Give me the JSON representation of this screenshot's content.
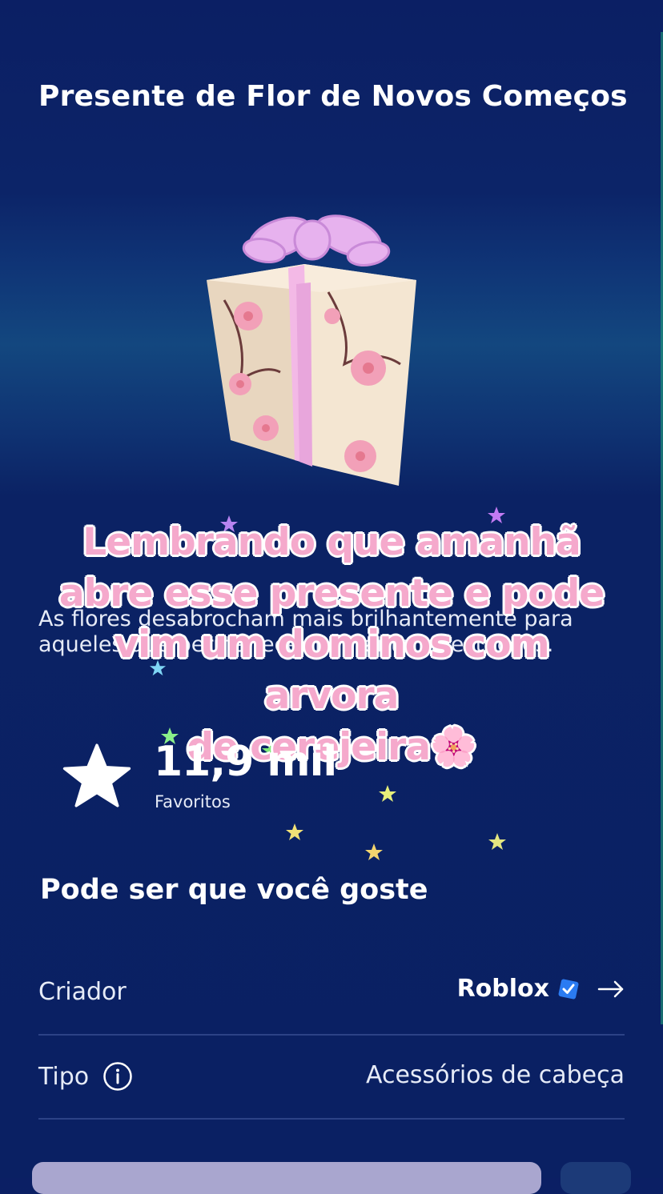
{
  "item": {
    "title": "Presente de Flor de Novos Começos",
    "description": "As flores desabrocham mais brilhantemente para aqueles que permanecem durante as estações."
  },
  "overlay_caption": {
    "line1": "Lembrando que amanhã",
    "line2": "abre esse presente e pode",
    "line3": "vim um dominos com arvora",
    "line4": "de cerejeira🌸"
  },
  "favorites": {
    "count": "11,9 mil",
    "label": "Favoritos"
  },
  "recommendations": {
    "title": "Pode ser que você goste"
  },
  "details": {
    "creator_label": "Criador",
    "creator_name": "Roblox",
    "type_label": "Tipo",
    "type_value": "Acessórios de cabeça"
  },
  "colors": {
    "background": "#0b2264",
    "overlay_text": "#f5a9cc",
    "verified_badge": "#2a7bf2",
    "buy_button": "#a9a6cf"
  },
  "icons": {
    "favorite": "star-icon",
    "verified": "verified-badge-icon",
    "creator_link": "arrow-right-icon",
    "type_info": "info-icon"
  }
}
